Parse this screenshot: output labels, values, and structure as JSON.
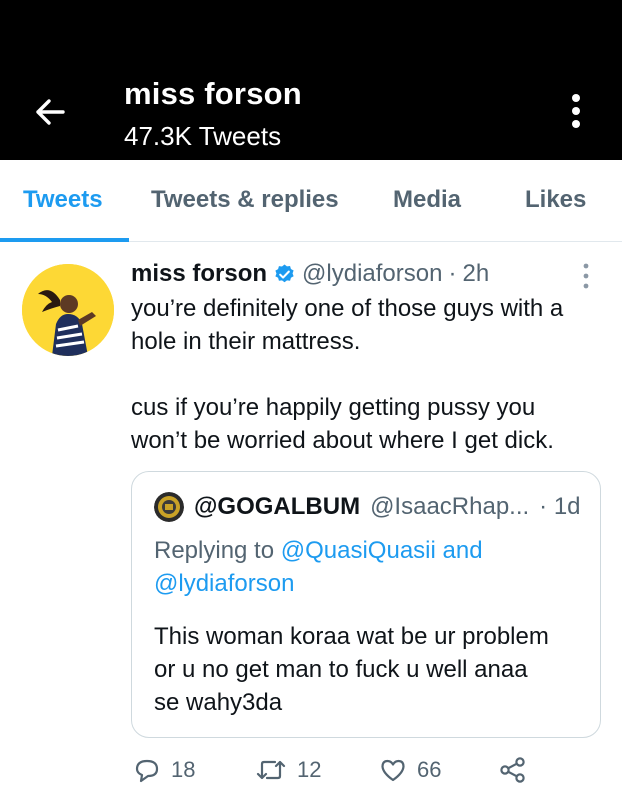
{
  "header": {
    "title": "miss forson",
    "subtitle": "47.3K Tweets",
    "back_icon": "arrow-left-icon",
    "more_icon": "more-vertical-icon"
  },
  "tabs": [
    {
      "label": "Tweets",
      "active": true
    },
    {
      "label": "Tweets & replies",
      "active": false
    },
    {
      "label": "Media",
      "active": false
    },
    {
      "label": "Likes",
      "active": false
    }
  ],
  "tweet": {
    "name": "miss forson",
    "handle": "@lydiaforson",
    "separator": "·",
    "time": "2h",
    "lines": [
      "you’re definitely one of those guys with a",
      "hole in their mattress.",
      "cus if you’re happily getting pussy you",
      "won’t be worried about where I get dick."
    ],
    "quote": {
      "name": "@GOGALBUM",
      "handle": "@IsaacRhap...",
      "time": "· 1d",
      "replying_prefix": "Replying to",
      "replying_to_1": "@QuasiQuasii",
      "replying_and": "and",
      "replying_to_2": "@lydiaforson",
      "lines": [
        "This woman koraa wat be ur problem",
        "or u no get man to fuck u well anaa",
        "se wahy3da"
      ]
    },
    "stats": {
      "replies": "18",
      "retweets": "12",
      "likes": "66"
    }
  },
  "colors": {
    "header_bg": "#000000",
    "accent": "#1d9bf0",
    "secondary_text": "#536471",
    "avatar_bg": "#fdd835"
  }
}
